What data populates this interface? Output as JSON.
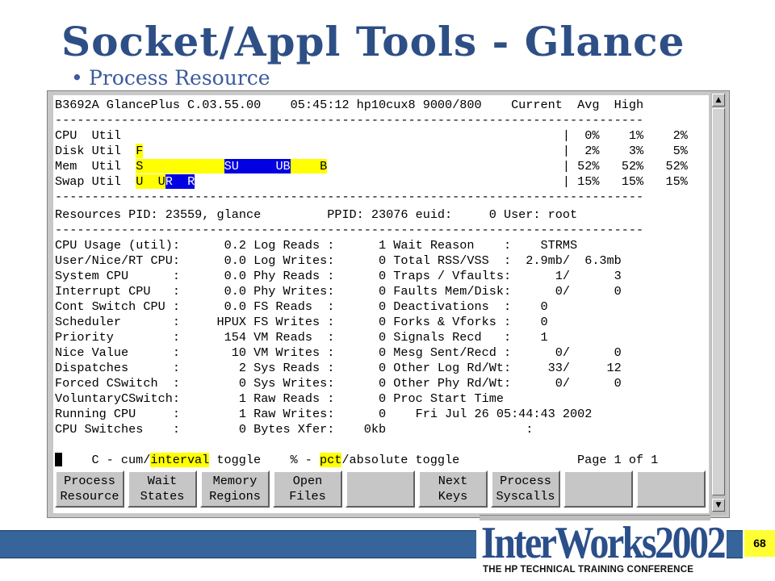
{
  "slide": {
    "title": "Socket/Appl Tools - Glance",
    "bullet": "Process Resource",
    "page_number": "68"
  },
  "logo": {
    "main": "InterWorks2002",
    "sub": "THE HP TECHNICAL TRAINING CONFERENCE"
  },
  "terminal": {
    "header": "B3692A GlancePlus C.03.55.00    05:45:12 hp10cux8 9000/800    Current  Avg  High",
    "divider": "--------------------------------------------------------------------------------",
    "util_rows": [
      {
        "label": "CPU  Util  ",
        "bar_segments": [],
        "stats": "|  0%    1%    2%"
      },
      {
        "label": "Disk Util  ",
        "bar_segments": [
          {
            "text": "F",
            "color": "yellow"
          }
        ],
        "stats": "|  2%    3%    5%"
      },
      {
        "label": "Mem  Util  ",
        "bar_segments": [
          {
            "text": "S           ",
            "color": "yellow"
          },
          {
            "text": "SU",
            "color": "blue"
          },
          {
            "text": "     UB",
            "color": "blue"
          },
          {
            "text": "    B",
            "color": "yellow"
          }
        ],
        "stats": "| 52%   52%   52%"
      },
      {
        "label": "Swap Util  ",
        "bar_segments": [
          {
            "text": "U  U",
            "color": "yellow"
          },
          {
            "text": "R  R",
            "color": "blue"
          }
        ],
        "stats": "| 15%   15%   15%"
      }
    ],
    "resources_line": "Resources PID: 23559, glance         PPID: 23076 euid:     0 User: root",
    "data_rows": [
      "CPU Usage (util):      0.2 Log Reads :      1 Wait Reason    :    STRMS",
      "User/Nice/RT CPU:      0.0 Log Writes:      0 Total RSS/VSS  :  2.9mb/  6.3mb",
      "System CPU      :      0.0 Phy Reads :      0 Traps / Vfaults:      1/      3",
      "Interrupt CPU   :      0.0 Phy Writes:      0 Faults Mem/Disk:      0/      0",
      "Cont Switch CPU :      0.0 FS Reads  :      0 Deactivations  :    0",
      "Scheduler       :     HPUX FS Writes :      0 Forks & Vforks :    0",
      "Priority        :      154 VM Reads  :      0 Signals Recd   :    1",
      "Nice Value      :       10 VM Writes :      0 Mesg Sent/Recd :      0/      0",
      "Dispatches      :        2 Sys Reads :      0 Other Log Rd/Wt:     33/     12",
      "Forced CSwitch  :        0 Sys Writes:      0 Other Phy Rd/Wt:      0/      0",
      "VoluntaryCSwitch:        1 Raw Reads :      0 Proc Start Time",
      "Running CPU     :        1 Raw Writes:      0    Fri Jul 26 05:44:43 2002",
      "CPU Switches    :        0 Bytes Xfer:    0kb                   :"
    ],
    "status": {
      "pre": "    C - cum/",
      "interval": "interval",
      "mid": " toggle    % - ",
      "pct": "pct",
      "post": "/absolute toggle",
      "page": "Page 1 of 1"
    },
    "function_keys": [
      "Process\nResource",
      "Wait\nStates",
      "Memory\nRegions",
      "Open\nFiles",
      "",
      "Next\nKeys",
      "Process\nSyscalls",
      "",
      ""
    ]
  },
  "colors": {
    "title": "#2e4f86",
    "bar_yellow": "#ffff00",
    "bar_blue": "#0000e0",
    "footer_bar": "#35659a",
    "page_box": "#ffff33"
  }
}
